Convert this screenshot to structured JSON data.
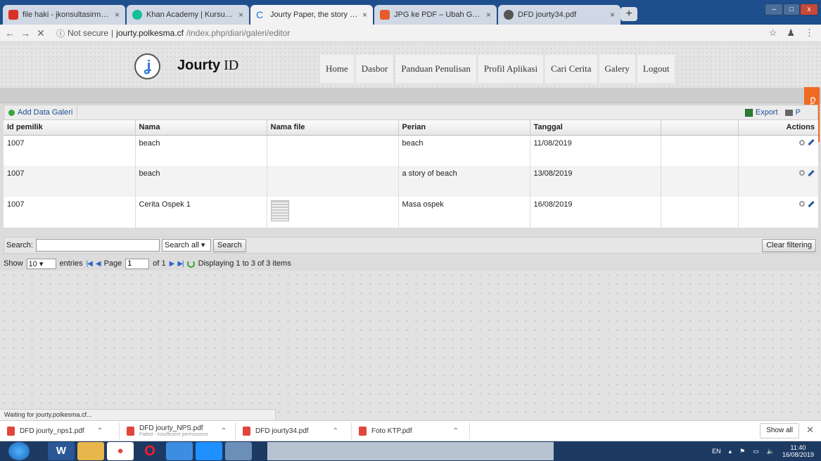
{
  "browser": {
    "tabs": [
      {
        "label": "file haki - jkonsultasirm@gmail.co",
        "favicon_color": "#d93025"
      },
      {
        "label": "Khan Academy | Kursus, Pelajaran",
        "favicon_color": "#14bf96"
      },
      {
        "label": "Jourty Paper, the story behind us",
        "favicon_color": "#1a73e8"
      },
      {
        "label": "JPG ke PDF – Ubah Gambar JPG",
        "favicon_color": "#e65c2d"
      },
      {
        "label": "DFD jourty34.pdf",
        "favicon_color": "#555555"
      }
    ],
    "new_tab": "+",
    "window_controls": {
      "minimize": "–",
      "maximize": "□",
      "close": "x"
    },
    "address": {
      "security": "Not secure",
      "domain": "jourty.polkesma.cf",
      "path": "/index.php/diari/galeri/editor"
    },
    "status": "Waiting for jourty.polkesma.cf..."
  },
  "site": {
    "logo_glyph": "ʝ",
    "brand_bold": "Jourty",
    "brand_light": " ID",
    "menu": [
      "Home",
      "Dasbor",
      "Panduan Penulisan",
      "Profil Aplikasi",
      "Cari Cerita",
      "Galery",
      "Logout"
    ],
    "customize": "Customize"
  },
  "grid": {
    "toolbar": {
      "add": "Add Data Galeri",
      "export": "Export",
      "print": "P"
    },
    "columns": [
      "Id pemilik",
      "Nama",
      "Nama file",
      "Perian",
      "Tanggal",
      "",
      "Actions"
    ],
    "rows": [
      {
        "id": "1007",
        "nama": "beach",
        "file": "",
        "perian": "beach",
        "tanggal": "11/08/2019",
        "has_thumb": false
      },
      {
        "id": "1007",
        "nama": "beach",
        "file": "",
        "perian": "a story of beach",
        "tanggal": "13/08/2019",
        "has_thumb": false
      },
      {
        "id": "1007",
        "nama": "Cerita Ospek 1",
        "file": "",
        "perian": "Masa ospek",
        "tanggal": "16/08/2019",
        "has_thumb": true
      }
    ],
    "search": {
      "label": "Search:",
      "value": "",
      "mode": "Search all",
      "button": "Search",
      "clear": "Clear filtering"
    },
    "pager": {
      "show": "Show",
      "per_page": "10",
      "entries": "entries",
      "page_label": "Page",
      "page": "1",
      "of": "of 1",
      "displaying": "Displaying 1 to 3 of 3 items"
    }
  },
  "downloads": [
    {
      "file": "DFD jourty_nps1.pdf",
      "note": ""
    },
    {
      "file": "DFD jourty_NPS.pdf",
      "note": "Failed - Insufficient permissions"
    },
    {
      "file": "DFD jourty34.pdf",
      "note": ""
    },
    {
      "file": "Foto KTP.pdf",
      "note": ""
    }
  ],
  "downloads_show_all": "Show all",
  "taskbar": {
    "lang": "EN",
    "time": "11:40",
    "date": "16/08/2019"
  }
}
